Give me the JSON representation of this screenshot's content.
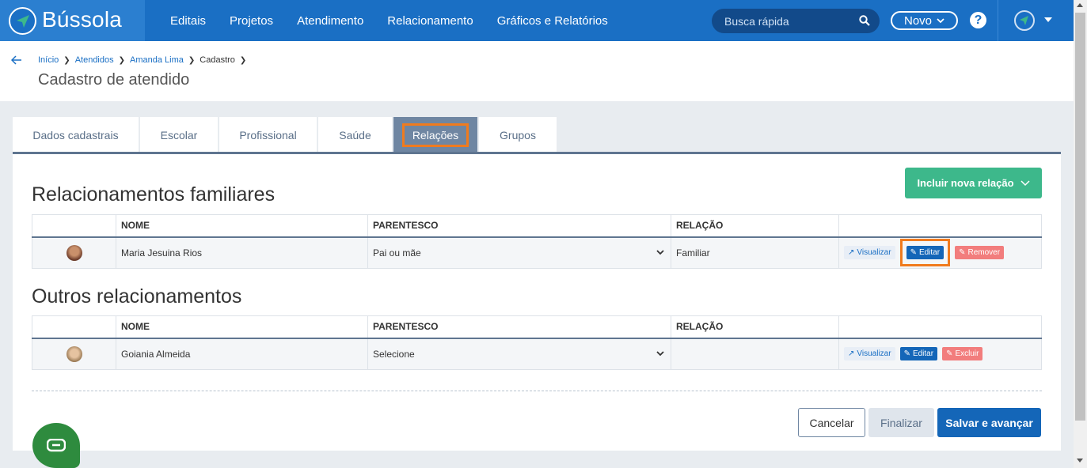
{
  "app": {
    "name": "Bússola",
    "nav": [
      "Editais",
      "Projetos",
      "Atendimento",
      "Relacionamento",
      "Gráficos e Relatórios"
    ],
    "search_placeholder": "Busca rápida",
    "new_label": "Novo",
    "help_label": "?"
  },
  "breadcrumb": [
    "Início",
    "Atendidos",
    "Amanda Lima",
    "Cadastro"
  ],
  "page_title": "Cadastro de atendido",
  "tabs": [
    "Dados cadastrais",
    "Escolar",
    "Profissional",
    "Saúde",
    "Relações",
    "Grupos"
  ],
  "active_tab": "Relações",
  "include_button": "Incluir nova relação",
  "family": {
    "title": "Relacionamentos familiares",
    "headers": [
      "NOME",
      "PARENTESCO",
      "RELAÇÃO"
    ],
    "rows": [
      {
        "name": "Maria Jesuina Rios",
        "parentesco": "Pai ou mãe",
        "relacao": "Familiar",
        "actions": [
          "Visualizar",
          "Editar",
          "Remover"
        ]
      }
    ]
  },
  "others": {
    "title": "Outros relacionamentos",
    "headers": [
      "NOME",
      "PARENTESCO",
      "RELAÇÃO"
    ],
    "rows": [
      {
        "name": "Goiania Almeida",
        "parentesco": "Selecione",
        "relacao": "",
        "actions": [
          "Visualizar",
          "Editar",
          "Excluir"
        ]
      }
    ]
  },
  "footer": {
    "cancel": "Cancelar",
    "finalize": "Finalizar",
    "save": "Salvar e avançar"
  },
  "colors": {
    "brand": "#1a6fc4",
    "success": "#3db88b",
    "danger": "#f27d7d",
    "highlight": "#f07b1e"
  }
}
